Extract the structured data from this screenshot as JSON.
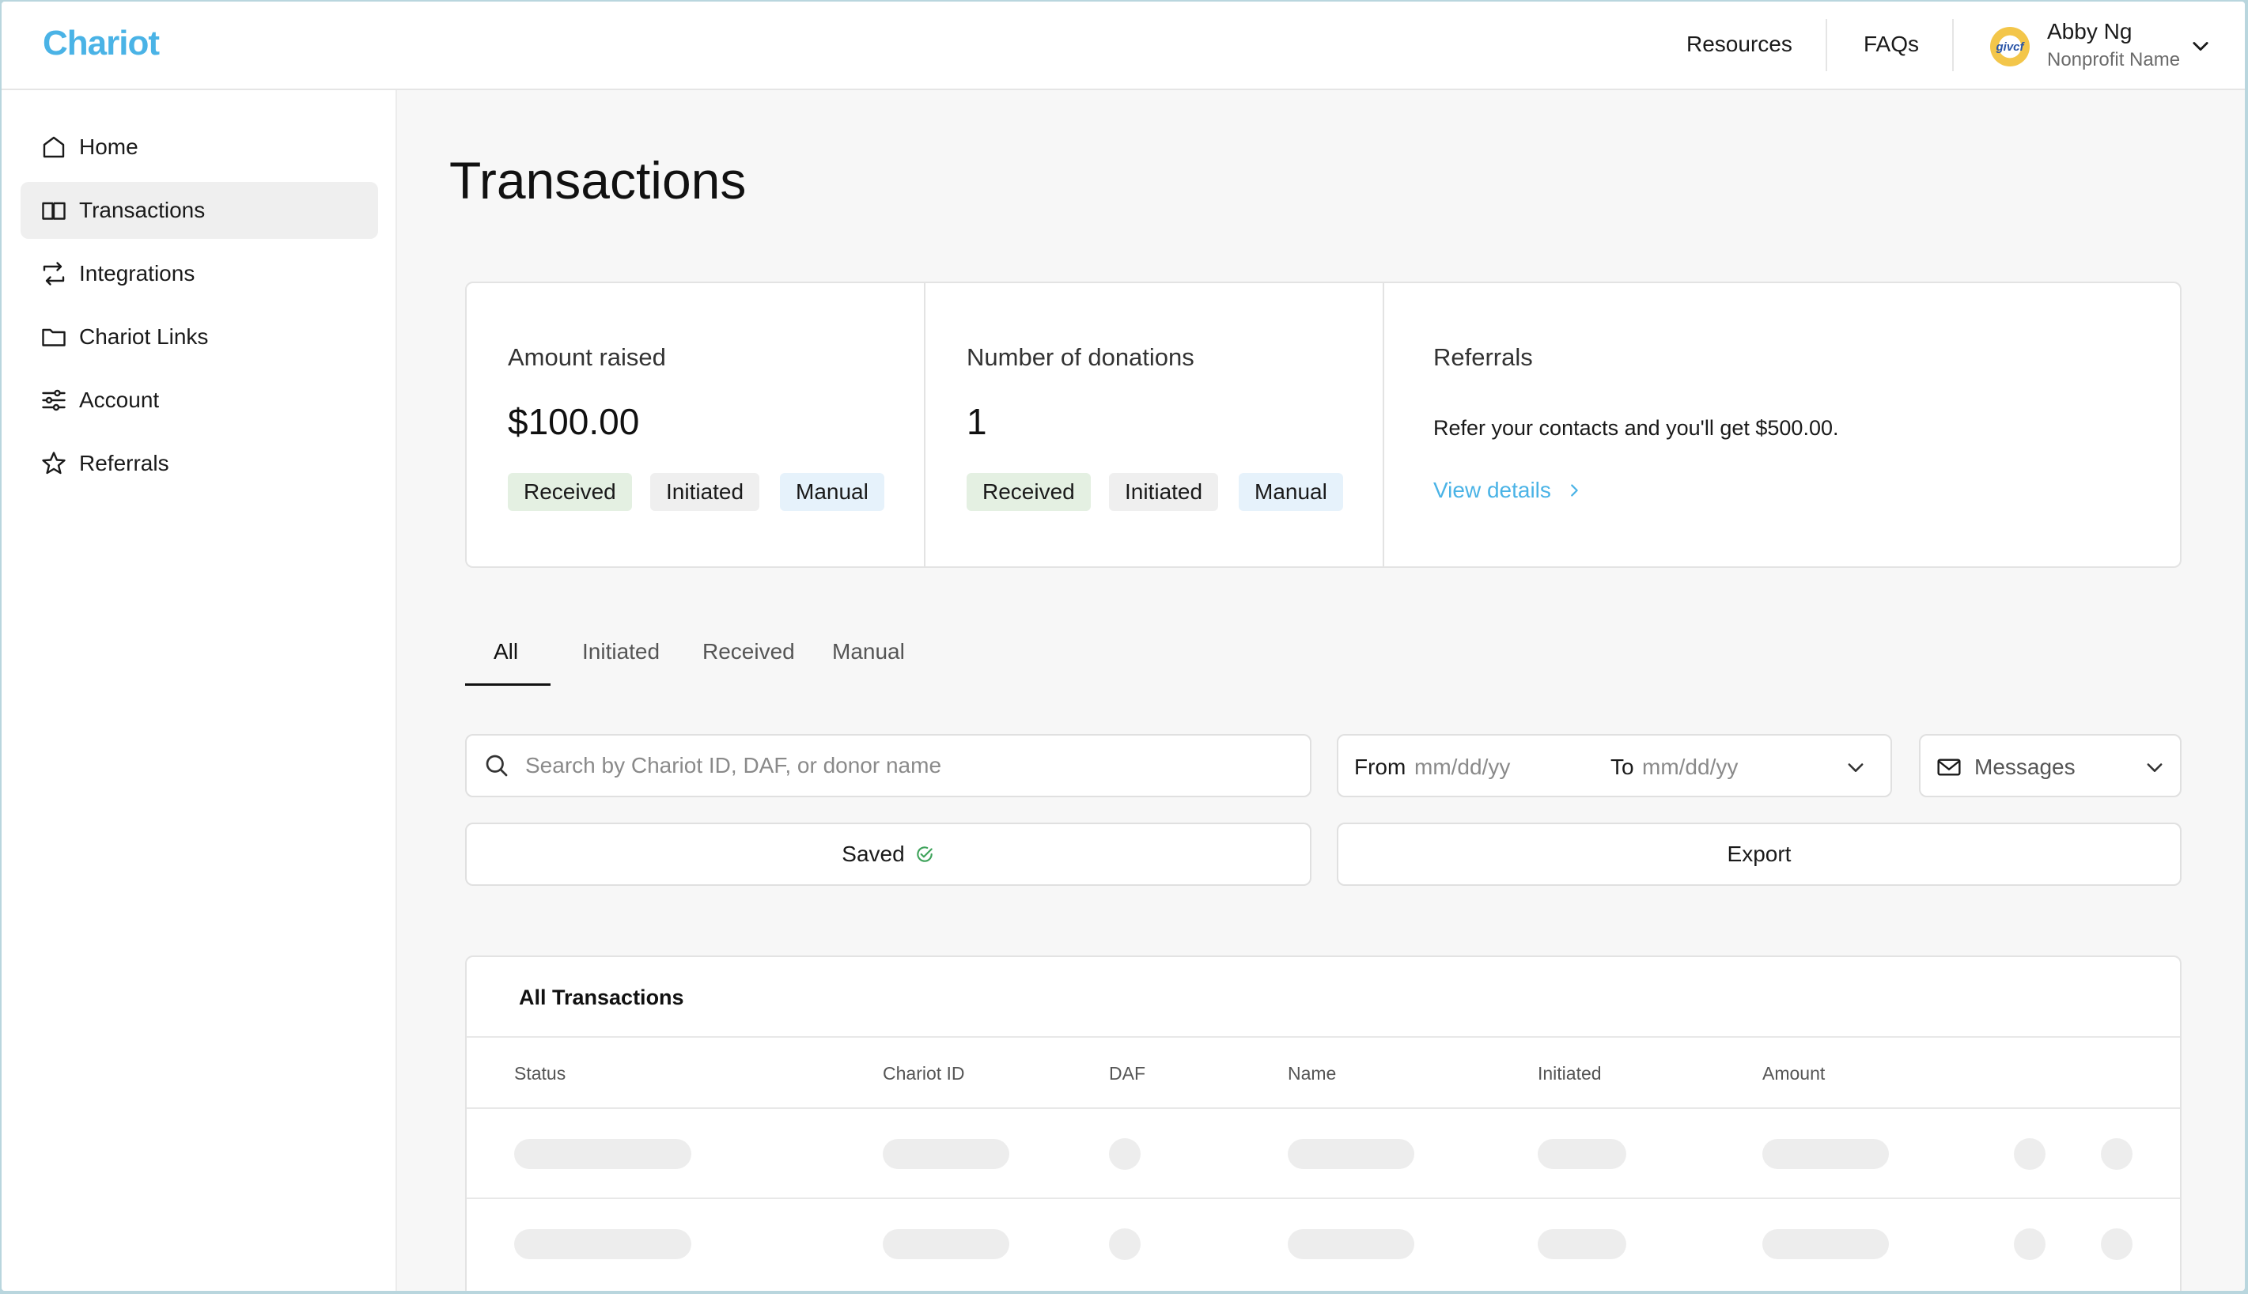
{
  "app": {
    "logo": "Chariot",
    "colors": {
      "accent": "#4ab3e6",
      "received_pill": "#e4f0e2",
      "initiated_pill": "#efefef",
      "manual_pill": "#e6f2fb"
    }
  },
  "header": {
    "links": [
      "Resources",
      "FAQs"
    ],
    "user": {
      "name": "Abby Ng",
      "org": "Nonprofit Name",
      "avatar_text": "givcf"
    }
  },
  "sidebar": {
    "items": [
      {
        "label": "Home",
        "icon": "home-icon"
      },
      {
        "label": "Transactions",
        "icon": "book-icon",
        "active": true
      },
      {
        "label": "Integrations",
        "icon": "sync-icon"
      },
      {
        "label": "Chariot Links",
        "icon": "folder-icon"
      },
      {
        "label": "Account",
        "icon": "sliders-icon"
      },
      {
        "label": "Referrals",
        "icon": "star-icon"
      }
    ]
  },
  "page": {
    "title": "Transactions"
  },
  "stats": {
    "amount": {
      "label": "Amount raised",
      "value": "$100.00",
      "pills": [
        "Received",
        "Initiated",
        "Manual"
      ]
    },
    "donations": {
      "label": "Number of donations",
      "value": "1",
      "pills": [
        "Received",
        "Initiated",
        "Manual"
      ]
    },
    "referrals": {
      "label": "Referrals",
      "text": "Refer your contacts and you'll get $500.00.",
      "link": "View details"
    }
  },
  "tabs": [
    "All",
    "Initiated",
    "Received",
    "Manual"
  ],
  "filters": {
    "search_placeholder": "Search by Chariot ID, DAF, or donor name",
    "from_label": "From",
    "from_placeholder": "mm/dd/yy",
    "to_label": "To",
    "to_placeholder": "mm/dd/yy",
    "messages_label": "Messages"
  },
  "actions": {
    "saved": "Saved",
    "export": "Export"
  },
  "table": {
    "title": "All Transactions",
    "columns": [
      "Status",
      "Chariot ID",
      "DAF",
      "Name",
      "Initiated",
      "Amount"
    ]
  }
}
